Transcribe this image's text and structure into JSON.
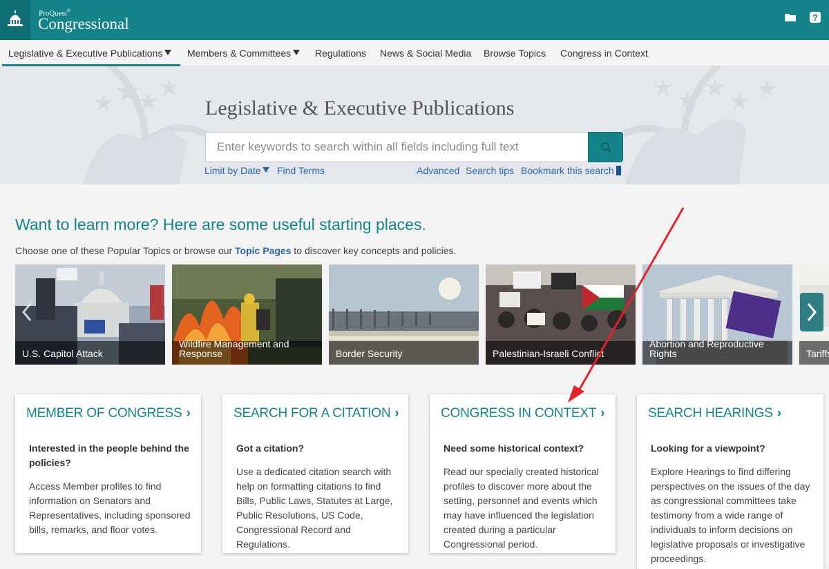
{
  "header": {
    "brand_small": "ProQuest",
    "brand_small_mark": "®",
    "brand_big": "Congressional",
    "icons": [
      "capitol-icon",
      "folder-icon",
      "help-icon"
    ],
    "colors": {
      "primary": "#15838a",
      "primary_dark": "#0f6e74",
      "link": "#2a65a8",
      "annotation": "#e0242b"
    }
  },
  "nav": {
    "items": [
      {
        "label": "Legislative & Executive Publications",
        "dropdown": true,
        "active": true
      },
      {
        "label": "Members & Committees",
        "dropdown": true
      },
      {
        "label": "Regulations"
      },
      {
        "label": "News & Social Media"
      },
      {
        "label": "Browse Topics"
      },
      {
        "label": "Congress in Context"
      }
    ]
  },
  "hero": {
    "title": "Legislative & Executive Publications",
    "search_placeholder": "Enter keywords to search within all fields including full text",
    "limit_by_date": "Limit by Date",
    "find_terms": "Find Terms",
    "advanced": "Advanced",
    "search_tips": "Search tips",
    "bookmark": "Bookmark this search"
  },
  "learn": {
    "heading": "Want to learn more? Here are some useful starting places.",
    "sub_prefix": "Choose one of these Popular Topics or browse our ",
    "sub_link": "Topic Pages",
    "sub_suffix": " to discover key concepts and policies."
  },
  "topics": [
    {
      "label": "U.S. Capitol Attack"
    },
    {
      "label": "Wildfire Management and Response"
    },
    {
      "label": "Border Security"
    },
    {
      "label": "Palestinian-Israeli Conflict"
    },
    {
      "label": "Abortion and Reproductive Rights"
    },
    {
      "label": "Tariffs"
    }
  ],
  "cards": [
    {
      "title": "MEMBER OF CONGRESS",
      "question": "Interested in the people behind the policies?",
      "body": "Access Member profiles to find information on Senators and Representatives, including sponsored bills, remarks, and floor votes."
    },
    {
      "title": "SEARCH FOR A CITATION",
      "question": "Got a citation?",
      "body": "Use a dedicated citation search with help on formatting citations to find Bills, Public Laws, Statutes at Large, Public Resolutions, US Code, Congressional Record and Regulations."
    },
    {
      "title": "CONGRESS IN CONTEXT",
      "question": "Need some historical context?",
      "body": "Read our specially created historical profiles to discover more about the setting, personnel and events which may have influenced the legislation created during a particular Congressional period."
    },
    {
      "title": "SEARCH HEARINGS",
      "question": "Looking for a viewpoint?",
      "body": "Explore Hearings to find differing perspectives on the issues of the day as congressional committees take testimony from a wide range of individuals to inform decisions on legislative proposals or investigative proceedings."
    }
  ]
}
